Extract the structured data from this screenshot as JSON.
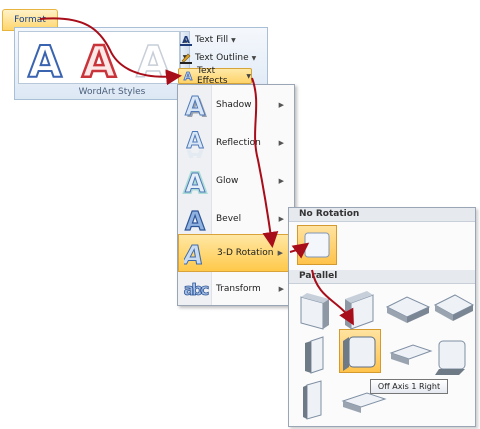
{
  "ribbon": {
    "tab_label": "Format",
    "group_label": "WordArt Styles",
    "text_fill": "Text Fill",
    "text_outline": "Text Outline",
    "text_effects": "Text Effects",
    "gallery_letters": [
      "A",
      "A",
      "A"
    ]
  },
  "effects_menu": {
    "items": [
      {
        "label": "Shadow",
        "icon": "shadow-icon"
      },
      {
        "label": "Reflection",
        "icon": "reflection-icon"
      },
      {
        "label": "Glow",
        "icon": "glow-icon"
      },
      {
        "label": "Bevel",
        "icon": "bevel-icon"
      },
      {
        "label": "3-D Rotation",
        "icon": "3d-rotation-icon"
      },
      {
        "label": "Transform",
        "icon": "transform-icon"
      }
    ]
  },
  "rotation_submenu": {
    "section_no_rotation": "No Rotation",
    "section_parallel": "Parallel",
    "tooltip": "Off Axis 1 Right"
  },
  "colors": {
    "highlight": "#ffc94a",
    "arrow": "#a80d1a",
    "letter_blue": "#3a63b0",
    "letter_red": "#c9343b"
  }
}
